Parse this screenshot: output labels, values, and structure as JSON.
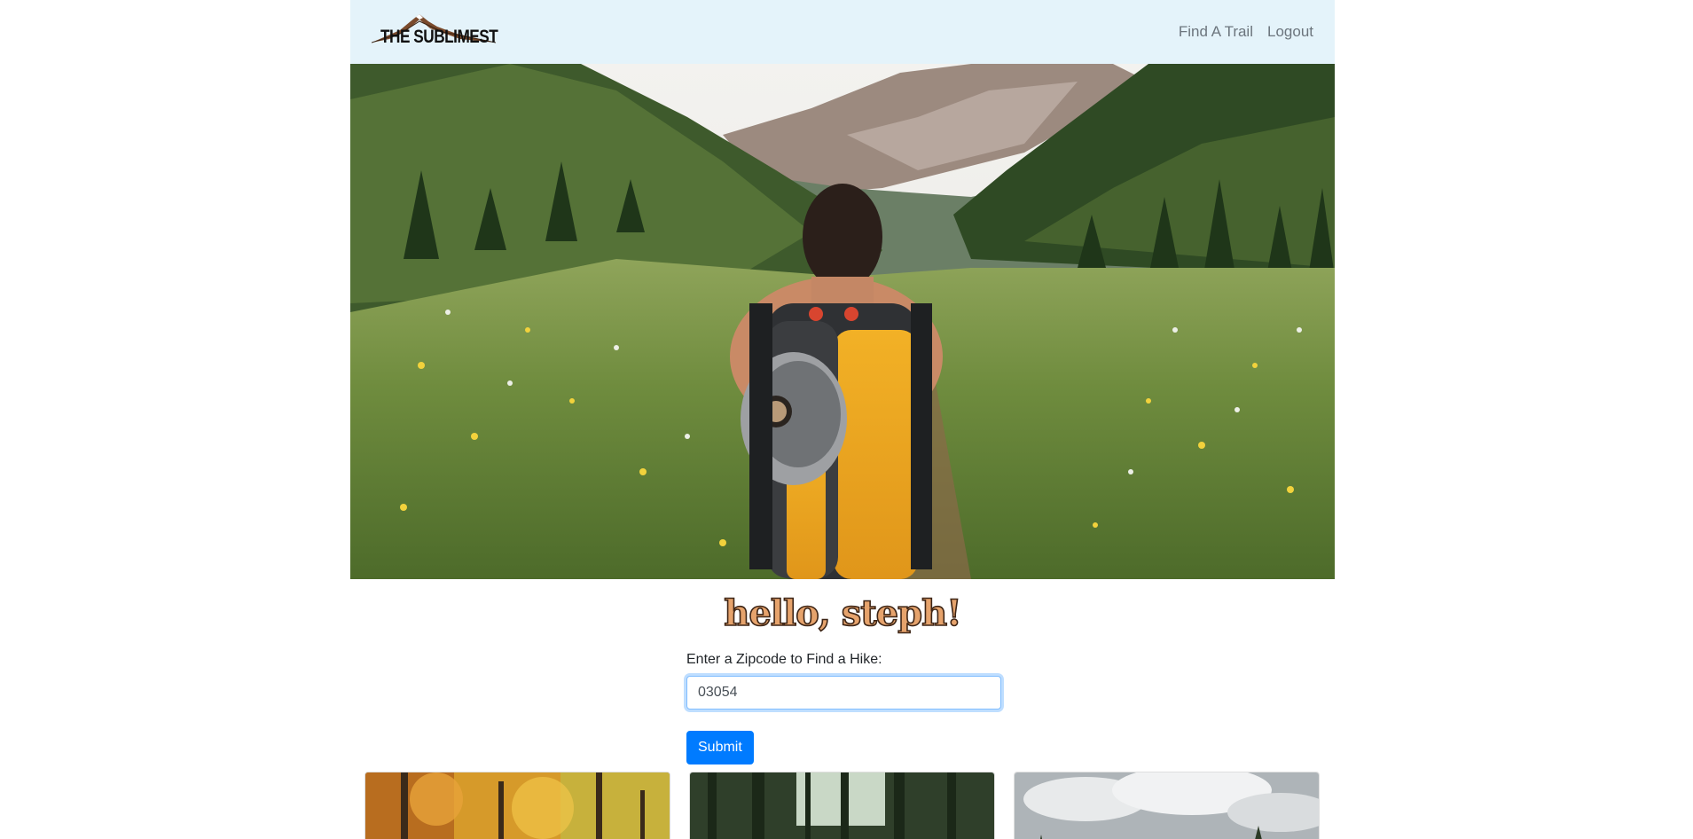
{
  "navbar": {
    "brand_name": "THE SUBLIMEST",
    "links": [
      {
        "label": "Find A Trail"
      },
      {
        "label": "Logout"
      }
    ]
  },
  "hero": {
    "image": "hiker-backpack-mountain-valley-photo"
  },
  "greeting": "hello, steph!",
  "search": {
    "label": "Enter a Zipcode to Find a Hike:",
    "value": "03054",
    "submit_label": "Submit"
  },
  "trail_cards": [
    {
      "image": "autumn-forest-photo"
    },
    {
      "image": "pine-forest-photo"
    },
    {
      "image": "cloudy-sky-treeline-photo"
    }
  ],
  "colors": {
    "navbar_bg": "#e4f3fa",
    "primary": "#007bff",
    "greeting_fill": "#e6a36c",
    "greeting_outline": "#3d2516"
  }
}
